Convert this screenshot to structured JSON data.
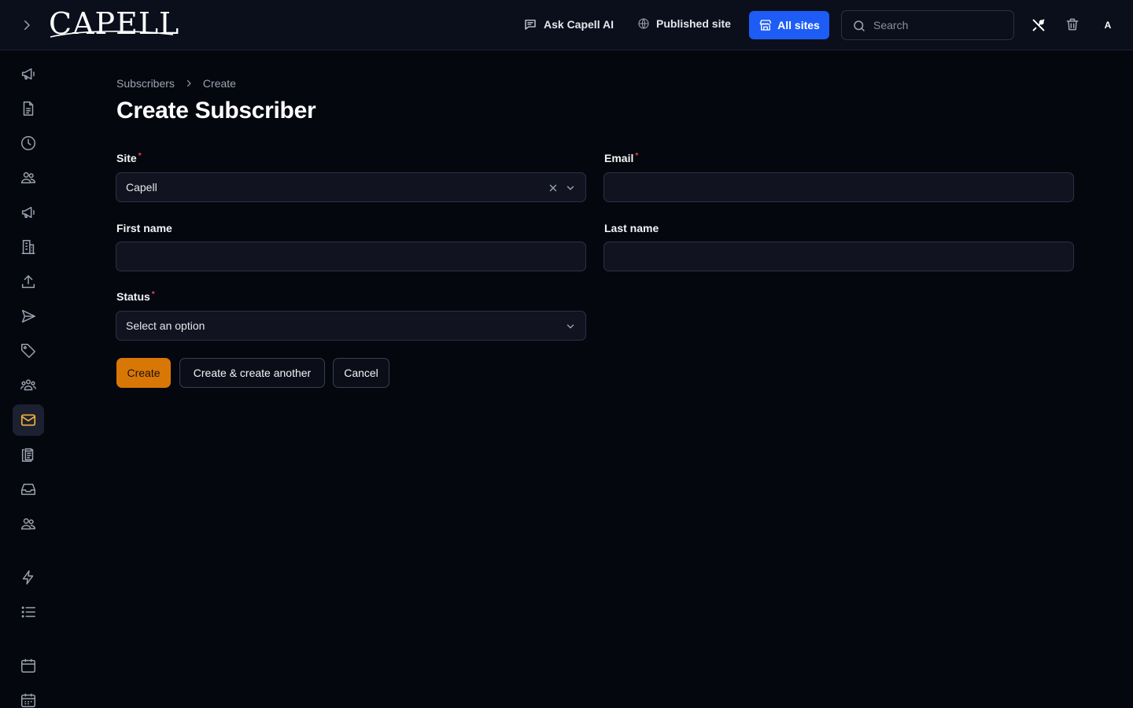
{
  "topbar": {
    "logo_text": "CAPELL",
    "ask_ai_label": "Ask Capell AI",
    "published_site_label": "Published site",
    "all_sites_label": "All sites",
    "search_placeholder": "Search",
    "avatar_initial": "A",
    "accent_color": "#1d5cf5"
  },
  "breadcrumb": {
    "items": [
      "Subscribers",
      "Create"
    ]
  },
  "page": {
    "title": "Create Subscriber"
  },
  "form": {
    "site": {
      "label": "Site",
      "value": "Capell"
    },
    "email": {
      "label": "Email",
      "value": "",
      "placeholder": ""
    },
    "first_name": {
      "label": "First name",
      "value": ""
    },
    "last_name": {
      "label": "Last name",
      "value": ""
    },
    "status": {
      "label": "Status",
      "placeholder": "Select an option"
    },
    "required_mark": "*"
  },
  "actions": {
    "create_label": "Create",
    "create_another_label": "Create & create another",
    "cancel_label": "Cancel",
    "primary_color": "#d97706"
  },
  "sidebar": {
    "icons": [
      "megaphone-icon",
      "document-icon",
      "clock-icon",
      "users-icon",
      "megaphone-icon",
      "building-icon",
      "upload-icon",
      "send-icon",
      "tag-icon",
      "user-group-icon",
      "envelope-icon",
      "clipboard-icon",
      "inbox-icon",
      "users-icon",
      "bolt-icon",
      "list-icon",
      "calendar-icon",
      "calendar-days-icon"
    ],
    "active_icon": "envelope-icon",
    "active_color": "#f5b33d"
  }
}
